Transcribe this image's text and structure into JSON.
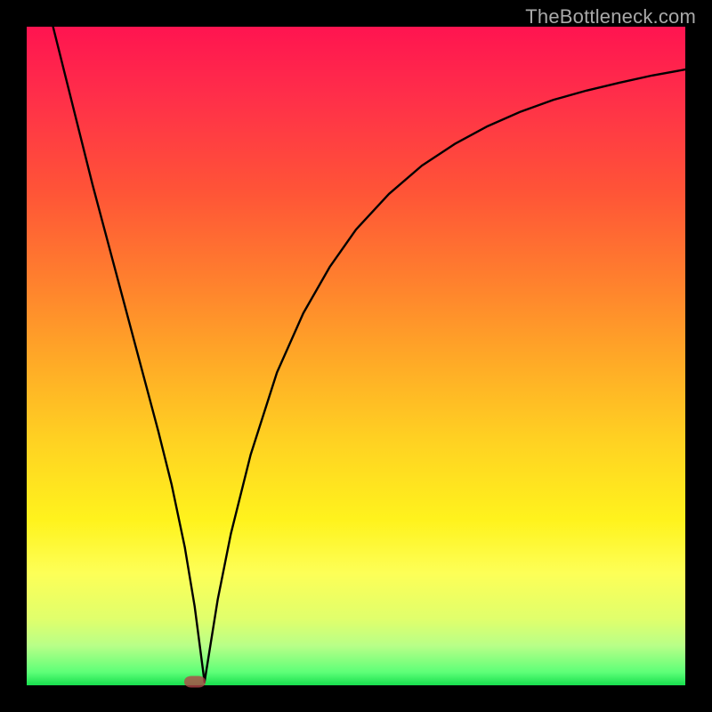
{
  "watermark": "TheBottleneck.com",
  "chart_data": {
    "type": "line",
    "title": "",
    "xlabel": "",
    "ylabel": "",
    "xlim": [
      0,
      100
    ],
    "ylim": [
      0,
      100
    ],
    "curve": {
      "x": [
        4,
        6,
        8,
        10,
        12,
        14,
        16,
        18,
        20,
        22,
        24,
        25.5,
        27,
        29,
        31,
        34,
        38,
        42,
        46,
        50,
        55,
        60,
        65,
        70,
        75,
        80,
        85,
        90,
        95,
        100
      ],
      "y": [
        100,
        92,
        84,
        76,
        68.5,
        61,
        53.5,
        46,
        38.5,
        30.5,
        21,
        12,
        0.5,
        13,
        23,
        35,
        47.5,
        56.5,
        63.5,
        69.2,
        74.6,
        78.9,
        82.2,
        84.9,
        87.1,
        88.9,
        90.3,
        91.5,
        92.6,
        93.5
      ]
    },
    "minimum_point": {
      "x": 25.5,
      "y": 0.5
    },
    "background_gradient_meaning": "red (top) = high bottleneck, green (bottom) = low bottleneck"
  },
  "colors": {
    "page_bg": "#000000",
    "curve": "#000000",
    "marker": "#b34448",
    "watermark": "#a9a9a9"
  }
}
